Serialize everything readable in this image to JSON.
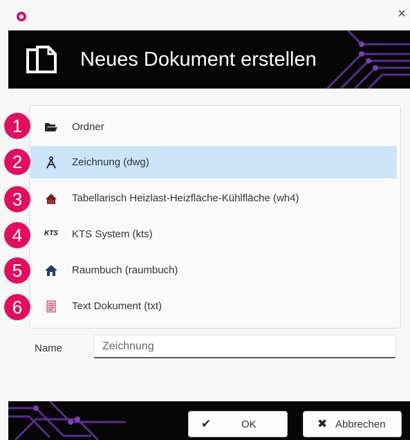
{
  "window": {
    "close_label": "×"
  },
  "banner": {
    "title": "Neues Dokument erstellen"
  },
  "items": [
    {
      "number": "1",
      "label": "Ordner",
      "icon": "folder-icon",
      "selected": false
    },
    {
      "number": "2",
      "label": "Zeichnung (dwg)",
      "icon": "compass-icon",
      "selected": true
    },
    {
      "number": "3",
      "label": "Tabellarisch Heizlast-Heizfläche-Kühlfläche (wh4)",
      "icon": "heating-icon",
      "selected": false
    },
    {
      "number": "4",
      "label": "KTS System (kts)",
      "icon": "kts-logo-icon",
      "icon_text": "KTS",
      "selected": false
    },
    {
      "number": "5",
      "label": "Raumbuch (raumbuch)",
      "icon": "house-icon",
      "selected": false
    },
    {
      "number": "6",
      "label": "Text Dokument (txt)",
      "icon": "text-document-icon",
      "selected": false
    }
  ],
  "name_field": {
    "label": "Name",
    "value": "Zeichnung"
  },
  "buttons": {
    "ok_label": "OK",
    "ok_icon": "✔",
    "cancel_label": "Abbrechen",
    "cancel_icon": "✖"
  },
  "colors": {
    "badge": "#e0105e",
    "selection": "#cce4f7",
    "banner": "#050505",
    "circuit": "#5a2d8c"
  }
}
